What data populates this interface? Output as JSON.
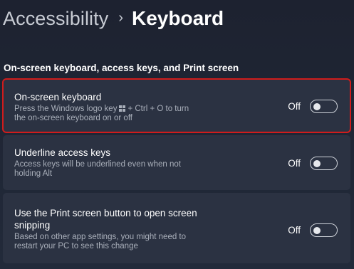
{
  "breadcrumb": {
    "parent": "Accessibility",
    "separator": "›",
    "current": "Keyboard"
  },
  "section": {
    "title": "On-screen keyboard, access keys, and Print screen"
  },
  "settings": [
    {
      "title": "On-screen keyboard",
      "description_line1_before_logo": "Press the Windows logo key",
      "description_line1_after_logo": "+ Ctrl + O to turn",
      "description_line2": "the on-screen keyboard on or off",
      "state": "Off",
      "toggle_on": false,
      "highlighted": true
    },
    {
      "title": "Underline access keys",
      "description_line1": "Access keys will be underlined even when not",
      "description_line2": "holding Alt",
      "state": "Off",
      "toggle_on": false
    },
    {
      "title_line1": "Use the Print screen button to open screen",
      "title_line2": "snipping",
      "description_line1": "Based on other app settings, you might need to",
      "description_line2": "restart your PC to see this change",
      "state": "Off",
      "toggle_on": false
    }
  ],
  "icons": {
    "breadcrumb_separator": "chevron-right-icon",
    "windows_logo": "windows-logo-icon"
  },
  "colors": {
    "highlight_border": "#d01c1c",
    "card_background": "#2b3242",
    "page_background": "#1f2532"
  }
}
